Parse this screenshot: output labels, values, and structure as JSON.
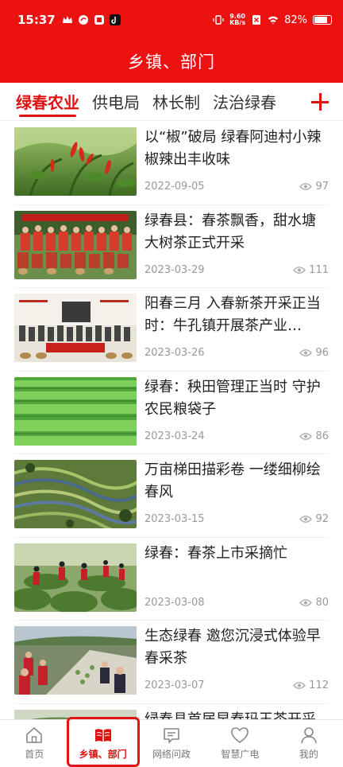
{
  "status_bar": {
    "time": "15:37",
    "net_speed_value": "9.60",
    "net_speed_unit": "KB/s",
    "battery": "82%",
    "battery_level": 0.82
  },
  "header": {
    "title": "乡镇、部门"
  },
  "tabs": {
    "items": [
      {
        "label": "绿春农业",
        "active": true
      },
      {
        "label": "供电局",
        "active": false
      },
      {
        "label": "林长制",
        "active": false
      },
      {
        "label": "法治绿春",
        "active": false
      }
    ],
    "add_icon": "plus-icon"
  },
  "articles": [
    {
      "title": "以“椒”破局 绿春阿迪村小辣椒辣出丰收味",
      "date": "2022-09-05",
      "views": "97",
      "image": "chili-field"
    },
    {
      "title": "绿春县：春茶飘香，甜水塘大树茶正式开采",
      "date": "2023-03-29",
      "views": "111",
      "image": "tea-group-photo"
    },
    {
      "title": "阳春三月 入春新茶开采正当时：牛孔镇开展茶产业…",
      "date": "2023-03-26",
      "views": "96",
      "image": "tea-event-banner"
    },
    {
      "title": "绿春：秧田管理正当时 守护农民粮袋子",
      "date": "2023-03-24",
      "views": "86",
      "image": "rice-seedlings"
    },
    {
      "title": "万亩梯田描彩卷 一缕细柳绘春风",
      "date": "2023-03-15",
      "views": "92",
      "image": "terraced-fields"
    },
    {
      "title": "绿春：春茶上市采摘忙",
      "date": "2023-03-08",
      "views": "80",
      "image": "tea-picking"
    },
    {
      "title": "生态绿春 邀您沉浸式体验早春采茶",
      "date": "2023-03-07",
      "views": "112",
      "image": "tea-feast"
    },
    {
      "title": "绿春县首届早春玛玉茶开采",
      "date": "",
      "views": "",
      "image": "tea-hills"
    }
  ],
  "bottom_nav": [
    {
      "label": "首页",
      "icon": "home-icon",
      "active": false
    },
    {
      "label": "乡镇、部门",
      "icon": "book-icon",
      "active": true
    },
    {
      "label": "网络问政",
      "icon": "message-icon",
      "active": false
    },
    {
      "label": "智慧广电",
      "icon": "heart-icon",
      "active": false
    },
    {
      "label": "我的",
      "icon": "user-icon",
      "active": false
    }
  ],
  "colors": {
    "brand_red": "#ee1111",
    "active_text": "#e01010",
    "muted": "#999999"
  }
}
